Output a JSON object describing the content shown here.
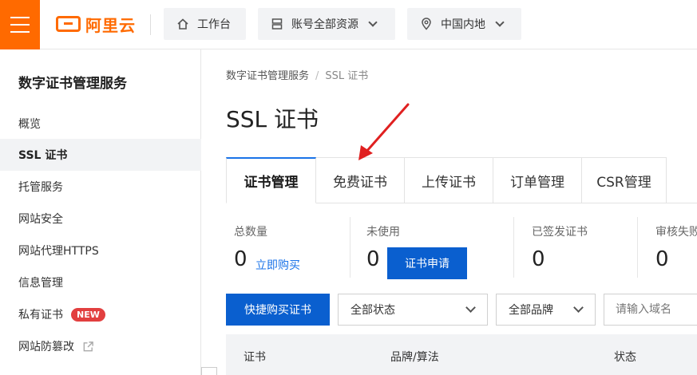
{
  "topbar": {
    "logo_text": "阿里云",
    "workbench_label": "工作台",
    "resources_label": "账号全部资源",
    "region_label": "中国内地",
    "accent_color": "#ff6a00"
  },
  "sidebar": {
    "title": "数字证书管理服务",
    "items": [
      {
        "label": "概览"
      },
      {
        "label": "SSL 证书",
        "active": true
      },
      {
        "label": "托管服务"
      },
      {
        "label": "网站安全"
      },
      {
        "label": "网站代理HTTPS"
      },
      {
        "label": "信息管理"
      },
      {
        "label": "私有证书",
        "badge": "NEW"
      },
      {
        "label": "网站防篡改",
        "icon": "external-link-icon"
      }
    ]
  },
  "breadcrumb": [
    "数字证书管理服务",
    "SSL 证书"
  ],
  "page_title": "SSL 证书",
  "tabs": [
    {
      "label": "证书管理",
      "active": true
    },
    {
      "label": "免费证书"
    },
    {
      "label": "上传证书"
    },
    {
      "label": "订单管理"
    },
    {
      "label": "CSR管理"
    }
  ],
  "stats": [
    {
      "label": "总数量",
      "value": "0",
      "action": "立即购买"
    },
    {
      "label": "未使用",
      "value": "0",
      "action": "证书申请"
    },
    {
      "label": "已签发证书",
      "value": "0"
    },
    {
      "label": "审核失败",
      "value": "0"
    }
  ],
  "filters": {
    "quick_buy": "快捷购买证书",
    "status_select": "全部状态",
    "brand_select": "全部品牌",
    "search_placeholder": "请输入域名"
  },
  "table": {
    "columns": [
      "证书",
      "品牌/算法",
      "状态"
    ]
  },
  "colors": {
    "primary": "#0a5fcf",
    "link": "#1a73e8",
    "badge": "#e23f3f",
    "annotation_arrow": "#e02020"
  }
}
